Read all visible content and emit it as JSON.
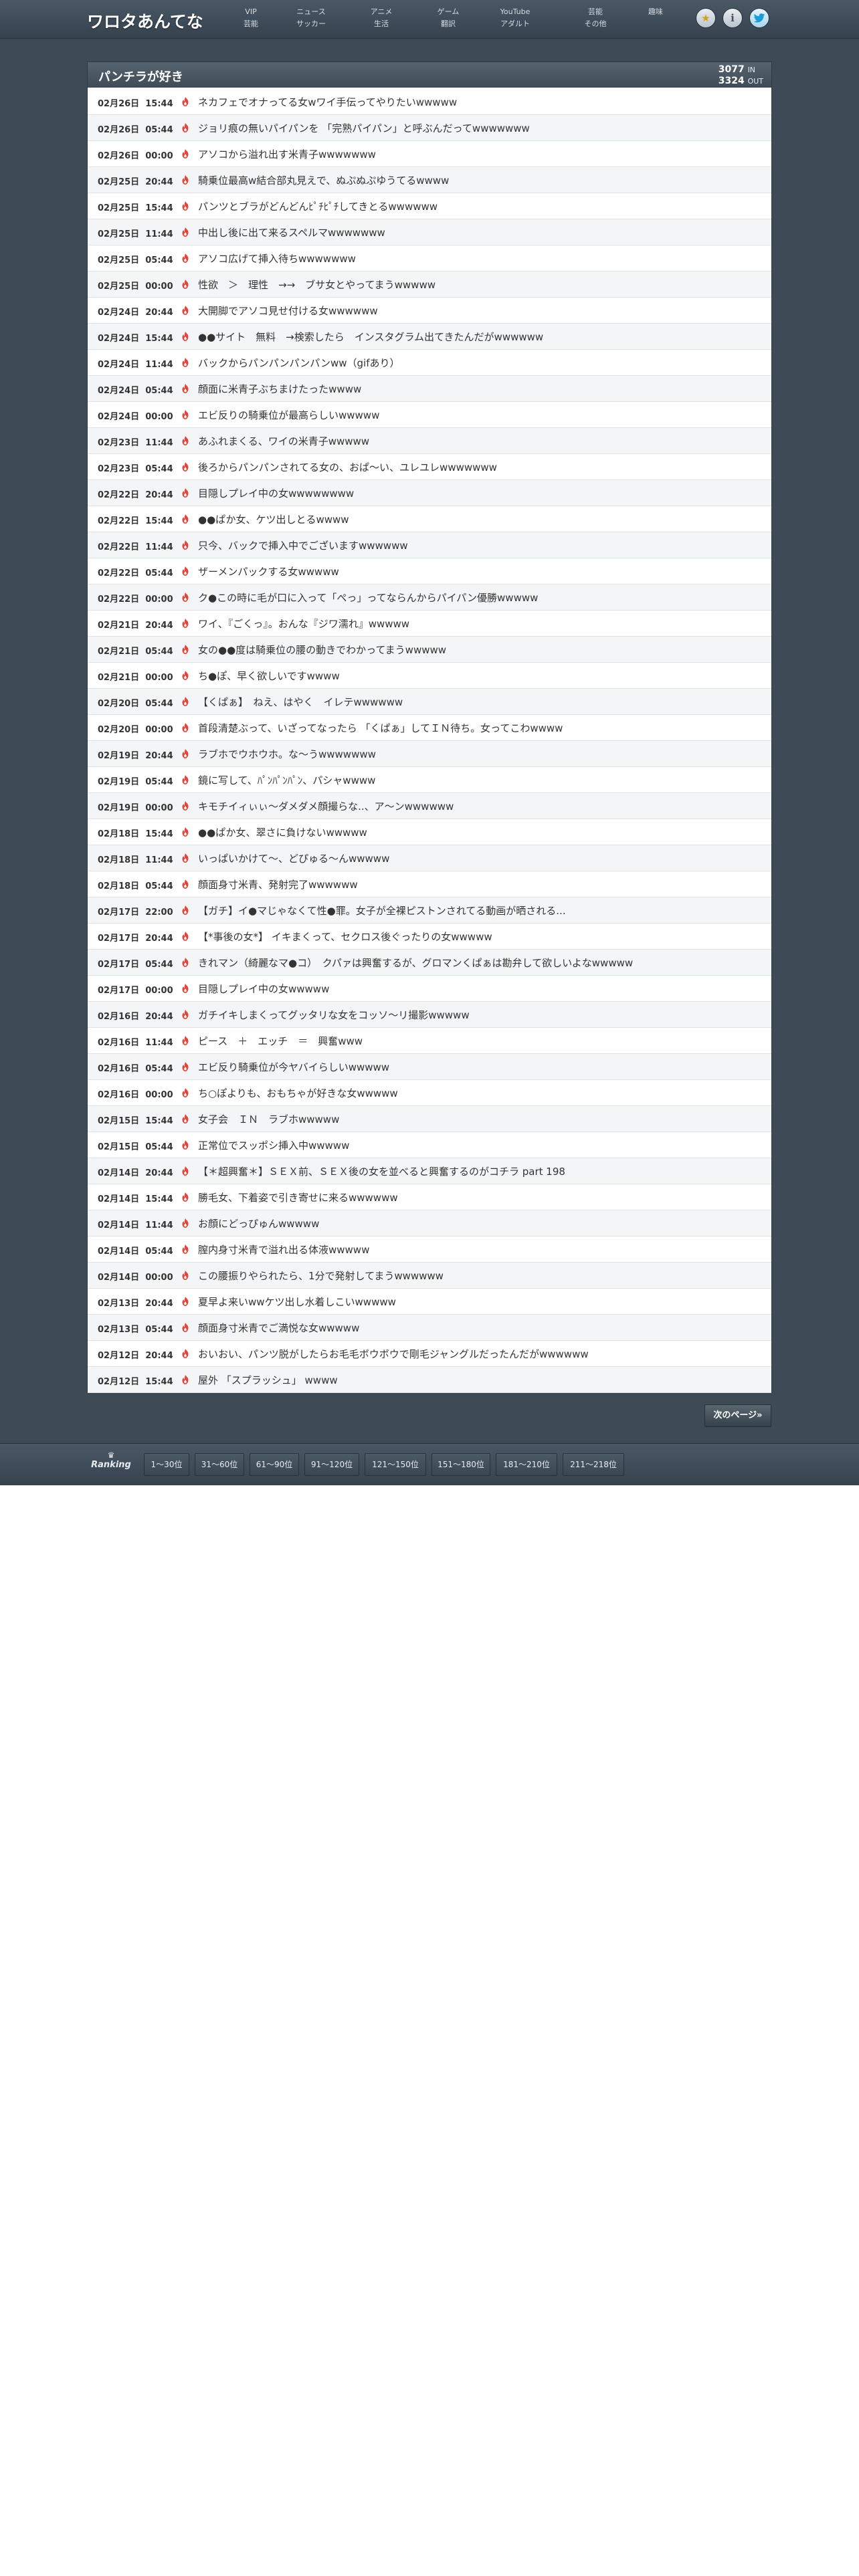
{
  "site": {
    "logo": "ワロタあんてな",
    "nav": [
      [
        "VIP",
        "芸能"
      ],
      [
        "ニュース",
        "サッカー"
      ],
      [
        "アニメ",
        "生活"
      ],
      [
        "ゲーム",
        "翻訳"
      ],
      [
        "YouTube",
        "アダルト"
      ],
      [
        "芸能",
        "その他"
      ],
      [
        "趣味",
        ""
      ]
    ],
    "icons": [
      "star-icon",
      "info-icon",
      "twitter-icon"
    ]
  },
  "panel": {
    "title": "パンチラが好き",
    "in_count": "3077",
    "in_label": "IN",
    "out_count": "3324",
    "out_label": "OUT"
  },
  "items": [
    {
      "date": "02月26日",
      "time": "15:44",
      "title": "ネカフェでオナってる女wワイ手伝ってやりたいwwwww"
    },
    {
      "date": "02月26日",
      "time": "05:44",
      "title": "ジョリ痕の無いパイパンを 「完熟パイパン」と呼ぶんだってwwwwwww"
    },
    {
      "date": "02月26日",
      "time": "00:00",
      "title": "アソコから溢れ出す米青子wwwwwww"
    },
    {
      "date": "02月25日",
      "time": "20:44",
      "title": "騎乗位最高w結合部丸見えで、ぬぷぬぷゆうてるwwww"
    },
    {
      "date": "02月25日",
      "time": "15:44",
      "title": "パンツとブラがどんどんﾋﾟﾁﾋﾟﾁしてきとるwwwwww"
    },
    {
      "date": "02月25日",
      "time": "11:44",
      "title": "中出し後に出て来るスペルマwwwwwww"
    },
    {
      "date": "02月25日",
      "time": "05:44",
      "title": "アソコ広げて挿入待ちwwwwwww"
    },
    {
      "date": "02月25日",
      "time": "00:00",
      "title": "性欲　＞　理性　→→　ブサ女とやってまうwwwww"
    },
    {
      "date": "02月24日",
      "time": "20:44",
      "title": "大開脚でアソコ見せ付ける女wwwwww"
    },
    {
      "date": "02月24日",
      "time": "15:44",
      "title": "●●サイト　無料　→検索したら　インスタグラム出てきたんだがwwwwww"
    },
    {
      "date": "02月24日",
      "time": "11:44",
      "title": "バックからパンパンパンパンww（gifあり）"
    },
    {
      "date": "02月24日",
      "time": "05:44",
      "title": "顔面に米青子ぶちまけたったwwww"
    },
    {
      "date": "02月24日",
      "time": "00:00",
      "title": "エビ反りの騎乗位が最高らしいwwwww"
    },
    {
      "date": "02月23日",
      "time": "11:44",
      "title": "あふれまくる、ワイの米青子wwwww"
    },
    {
      "date": "02月23日",
      "time": "05:44",
      "title": "後ろからパンパンされてる女の、おぱ～い、ユレユレwwwwwww"
    },
    {
      "date": "02月22日",
      "time": "20:44",
      "title": "目隠しプレイ中の女wwwwwwww"
    },
    {
      "date": "02月22日",
      "time": "15:44",
      "title": "●●ぱか女、ケツ出しとるwwww"
    },
    {
      "date": "02月22日",
      "time": "11:44",
      "title": "只今、バックで挿入中でございますwwwwww"
    },
    {
      "date": "02月22日",
      "time": "05:44",
      "title": "ザーメンパックする女wwwww"
    },
    {
      "date": "02月22日",
      "time": "00:00",
      "title": "ク●この時に毛が口に入って「ぺっ」ってならんからパイパン優勝wwwww"
    },
    {
      "date": "02月21日",
      "time": "20:44",
      "title": "ワイ、『ごくっ』。おんな『ジワ濡れ』wwwww"
    },
    {
      "date": "02月21日",
      "time": "05:44",
      "title": "女の●●度は騎乗位の腰の動きでわかってまうwwwww"
    },
    {
      "date": "02月21日",
      "time": "00:00",
      "title": "ち●ぽ、早く欲しいですwwww"
    },
    {
      "date": "02月20日",
      "time": "05:44",
      "title": "【くぱぁ】　ねえ、はやく　イレテwwwwww"
    },
    {
      "date": "02月20日",
      "time": "00:00",
      "title": "首段清楚ぶって、いざってなったら 「くぱぁ」してＩＮ待ち。女ってこわwwww"
    },
    {
      "date": "02月19日",
      "time": "20:44",
      "title": "ラブホでウホウホ。な～うwwwwwww"
    },
    {
      "date": "02月19日",
      "time": "05:44",
      "title": "鏡に写して、ﾊﾟﾝﾊﾟﾝﾊﾟﾝ、パシャwwww"
    },
    {
      "date": "02月19日",
      "time": "00:00",
      "title": "キモチイィぃぃ～ダメダメ顔撮らな..、ア～ンwwwwww"
    },
    {
      "date": "02月18日",
      "time": "15:44",
      "title": "●●ぱか女、翠さに負けないwwwww"
    },
    {
      "date": "02月18日",
      "time": "11:44",
      "title": "いっぱいかけて～、どぴゅる～んwwwww"
    },
    {
      "date": "02月18日",
      "time": "05:44",
      "title": "顔面身寸米青、発射完了wwwwww"
    },
    {
      "date": "02月17日",
      "time": "22:00",
      "title": "【ガチ】イ●マじゃなくて性●罪。女子が全裸ピストンされてる動画が晒される..."
    },
    {
      "date": "02月17日",
      "time": "20:44",
      "title": "【*事後の女*】 イキまくって、セクロス後ぐったりの女wwwww"
    },
    {
      "date": "02月17日",
      "time": "05:44",
      "title": "きれマン（綺麗なマ●コ）　クパァは興奮するが、グロマンくぱぁは勘弁して欲しいよなwwwww"
    },
    {
      "date": "02月17日",
      "time": "00:00",
      "title": "目隠しプレイ中の女wwwww"
    },
    {
      "date": "02月16日",
      "time": "20:44",
      "title": "ガチイキしまくってグッタリな女をコッソ〜リ撮影wwwww"
    },
    {
      "date": "02月16日",
      "time": "11:44",
      "title": "ピース　＋　エッチ　＝　興奮www"
    },
    {
      "date": "02月16日",
      "time": "05:44",
      "title": "エビ反り騎乗位が今ヤバイらしいwwwww"
    },
    {
      "date": "02月16日",
      "time": "00:00",
      "title": "ち○ぽよりも、おもちゃが好きな女wwwww"
    },
    {
      "date": "02月15日",
      "time": "15:44",
      "title": "女子会　ＩＮ　ラブホwwwww"
    },
    {
      "date": "02月15日",
      "time": "05:44",
      "title": "正常位でスッポシ挿入中wwwww"
    },
    {
      "date": "02月14日",
      "time": "20:44",
      "title": "【＊超興奮＊】ＳＥＸ前、ＳＥＸ後の女を並べると興奮するのがコチラ part 198"
    },
    {
      "date": "02月14日",
      "time": "15:44",
      "title": "勝毛女、下着姿で引き寄せに来るwwwwww"
    },
    {
      "date": "02月14日",
      "time": "11:44",
      "title": "お顔にどっぴゅんwwwww"
    },
    {
      "date": "02月14日",
      "time": "05:44",
      "title": "膣内身寸米青で溢れ出る体液wwwww"
    },
    {
      "date": "02月14日",
      "time": "00:00",
      "title": "この腰振りやられたら、1分で発射してまうwwwwww"
    },
    {
      "date": "02月13日",
      "time": "20:44",
      "title": "夏早よ来いwwケツ出し水着しこいwwwww"
    },
    {
      "date": "02月13日",
      "time": "05:44",
      "title": "顔面身寸米青でご満悦な女wwwww"
    },
    {
      "date": "02月12日",
      "time": "20:44",
      "title": "おいおい、パンツ脱がしたらお毛毛ボウボウで剛毛ジャングルだったんだがwwwwww"
    },
    {
      "date": "02月12日",
      "time": "15:44",
      "title": "屋外 「スプラッシュ」 wwww"
    }
  ],
  "next_page": "次のページ»",
  "footer": {
    "ranking_label": "Ranking",
    "ranges": [
      "1〜30位",
      "31〜60位",
      "61〜90位",
      "91〜120位",
      "121〜150位",
      "151〜180位",
      "181〜210位",
      "211〜218位"
    ]
  }
}
